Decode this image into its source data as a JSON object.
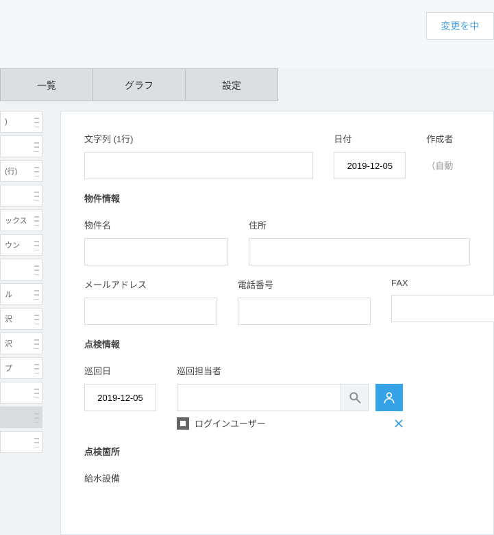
{
  "topbar": {
    "change_button": "変更を中"
  },
  "tabs": {
    "list": "一覧",
    "graph": "グラフ",
    "settings": "設定"
  },
  "sidebar": {
    "items": [
      ")",
      "",
      "(行)",
      "",
      "ックス",
      "ウン",
      "",
      "ル",
      "沢",
      "沢",
      "プ",
      "",
      "",
      ""
    ]
  },
  "form": {
    "string_label": "文字列 (1行)",
    "date_label": "日付",
    "date_value": "2019-12-05",
    "createdby_label": "作成者",
    "auto_text": "（自動",
    "property_section": "物件情報",
    "property_name_label": "物件名",
    "address_label": "住所",
    "mail_label": "メールアドレス",
    "phone_label": "電話番号",
    "fax_label": "FAX",
    "inspection_section": "点検情報",
    "round_date_label": "巡回日",
    "round_date_value": "2019-12-05",
    "person_label": "巡回担当者",
    "login_user_text": "ログインユーザー",
    "location_section": "点検箇所",
    "water_label": "給水設備"
  }
}
